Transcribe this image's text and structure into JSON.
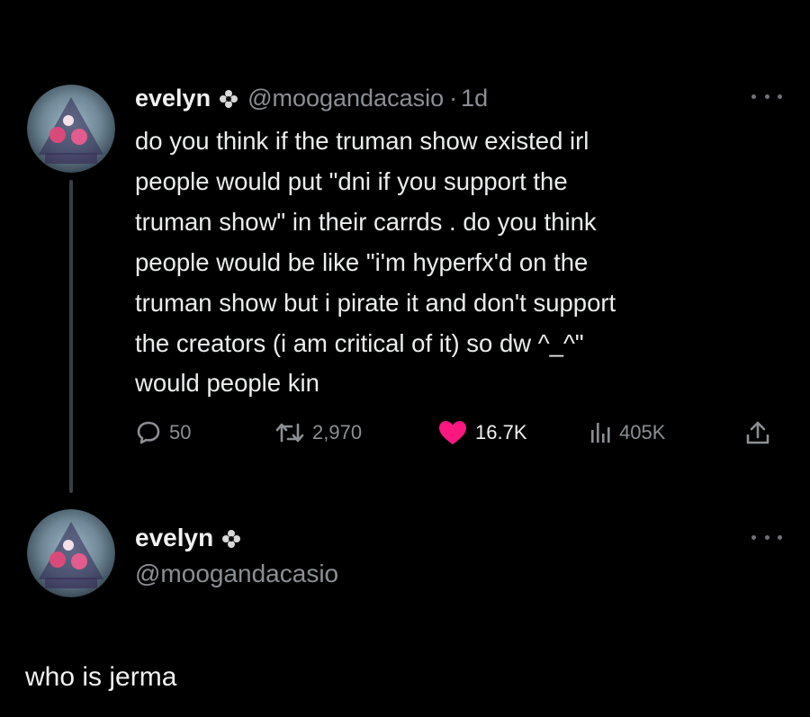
{
  "tweet": {
    "display_name": "evelyn",
    "handle": "@moogandacasio",
    "separator": "·",
    "time": "1d",
    "body": "do you think if the truman show existed irl\npeople would put \"dni if you support the\ntruman show\" in their carrds . do you think\npeople would be like \"i'm hyperfx'd on the\ntruman show but i pirate it and don't support\nthe creators (i am critical of it) so dw ^_^\"\nwould people kin",
    "actions": {
      "replies": "50",
      "retweets": "2,970",
      "likes": "16.7K",
      "views": "405K"
    },
    "liked": true
  },
  "reply": {
    "display_name": "evelyn",
    "handle": "@moogandacasio",
    "text": "who is jerma"
  },
  "icons": {
    "badge": "flower-badge-icon",
    "reply": "reply-bubble-icon",
    "retweet": "retweet-icon",
    "like": "heart-icon",
    "views": "views-bar-chart-icon",
    "share": "share-upload-icon",
    "more": "more-dots-icon"
  },
  "colors": {
    "background": "#000000",
    "text": "#e7e9ea",
    "muted": "#8b8f94",
    "like": "#f91880"
  }
}
